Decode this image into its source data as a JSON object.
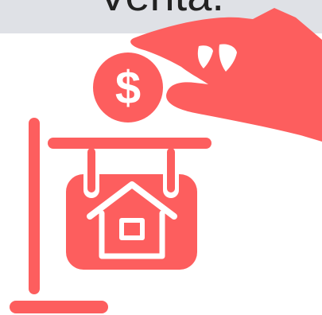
{
  "banner": {
    "title": "Venta."
  },
  "illustration": {
    "primary_color": "#fd5e5e",
    "background_color": "#ffffff",
    "banner_color": "#dfe1e6",
    "icons": [
      "hand-icon",
      "dollar-coin-icon",
      "for-sale-sign-icon",
      "house-icon"
    ]
  }
}
